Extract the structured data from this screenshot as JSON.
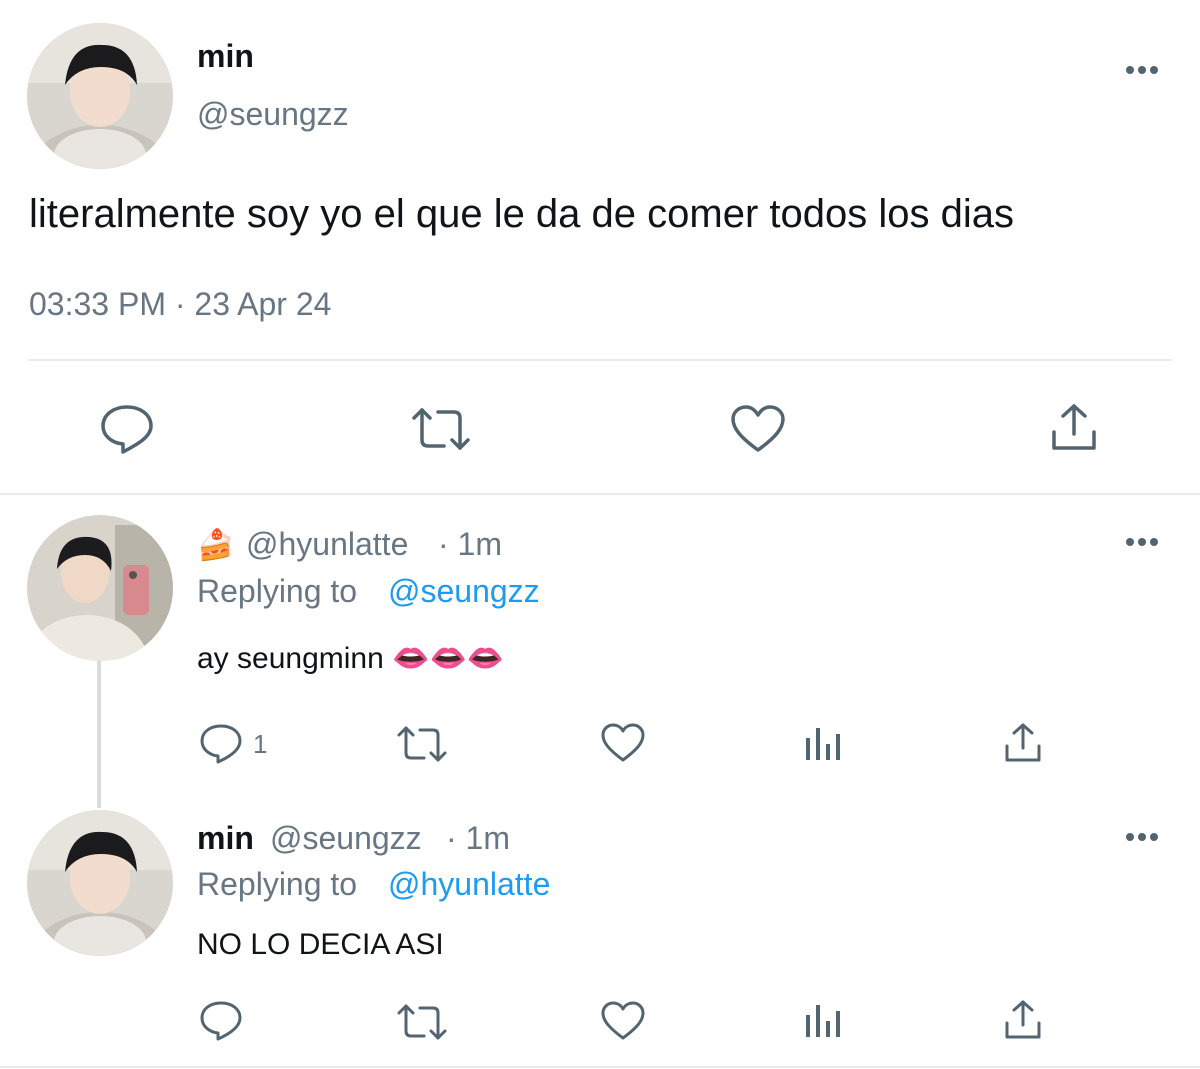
{
  "main_tweet": {
    "display_name": "min",
    "handle": "@seungzz",
    "text": "literalmente soy yo el que le da de comer todos los dias",
    "timestamp": "03:33 PM · 23 Apr 24"
  },
  "reply_1": {
    "emoji": "🍰",
    "handle": "@hyunlatte",
    "time": "· 1m",
    "replying_prefix": "Replying to",
    "replying_to": "@seungzz",
    "text": "ay seungminn 👄👄👄",
    "reply_count": "1"
  },
  "reply_2": {
    "display_name": "min",
    "handle": "@seungzz",
    "time": "· 1m",
    "replying_prefix": "Replying to",
    "replying_to": "@hyunlatte",
    "text": "NO LO DECIA ASI"
  },
  "icons": {
    "reply": "speech-bubble-icon",
    "retweet": "retweet-icon",
    "like": "heart-icon",
    "share": "share-icon",
    "views": "bar-chart-icon",
    "more": "more-dots-icon"
  },
  "colors": {
    "link": "#1d9bf0",
    "muted": "#687684",
    "icon": "#536471",
    "divider": "#e6ecf0"
  }
}
